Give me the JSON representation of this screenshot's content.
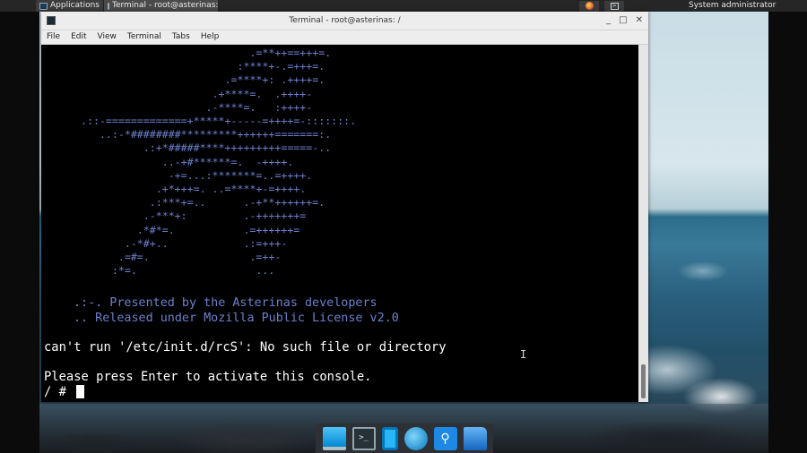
{
  "top_panel": {
    "applications_label": "Applications",
    "task_label": "Terminal - root@asterinas: /",
    "user_label": "System administrator"
  },
  "window": {
    "title": "Terminal - root@asterinas: /",
    "menu": [
      "File",
      "Edit",
      "View",
      "Terminal",
      "Tabs",
      "Help"
    ],
    "controls": {
      "minimize": "_",
      "maximize": "□",
      "close": "✕"
    }
  },
  "terminal": {
    "logo": "                            .=**++==+++=.\n                          :****+-.=+++=.\n                        .=****+: .++++=.\n                      .+****=.  .++++-\n                     .-****=.   :++++-\n .::-=============+*****+-----=++++=-:::::::.\n    ..:-*########*********++++++=======:.\n           .:+*#####****+++++++++=====-..\n              ..-+#******=.  -++++.\n               -+=...:*******=..=++++.\n             .+*+++=. ..=****+-=++++.\n            .:***+=..      .-+**++++++=.\n           .-***+:         .-+++++++=\n          .*#*=.           .=++++++=\n        .-*#+..            .:=+++-\n       .=#=.                .=++-\n      :*=.                   ...",
    "presented": ".:-. Presented by the Asterinas developers\n.. Released under Mozilla Public License v2.0",
    "error_line": "can't run '/etc/init.d/rcS': No such file or directory",
    "press_enter": "Please press Enter to activate this console.",
    "prompt": "/ # "
  },
  "colors": {
    "logo": "#6b80ce",
    "text": "#ffffff",
    "background": "#000000"
  },
  "dock": {
    "items": [
      "screen-icon",
      "terminal-icon",
      "phone-icon",
      "web-browser-icon",
      "search-icon",
      "folder-icon"
    ],
    "terminal_glyph": ">_"
  }
}
